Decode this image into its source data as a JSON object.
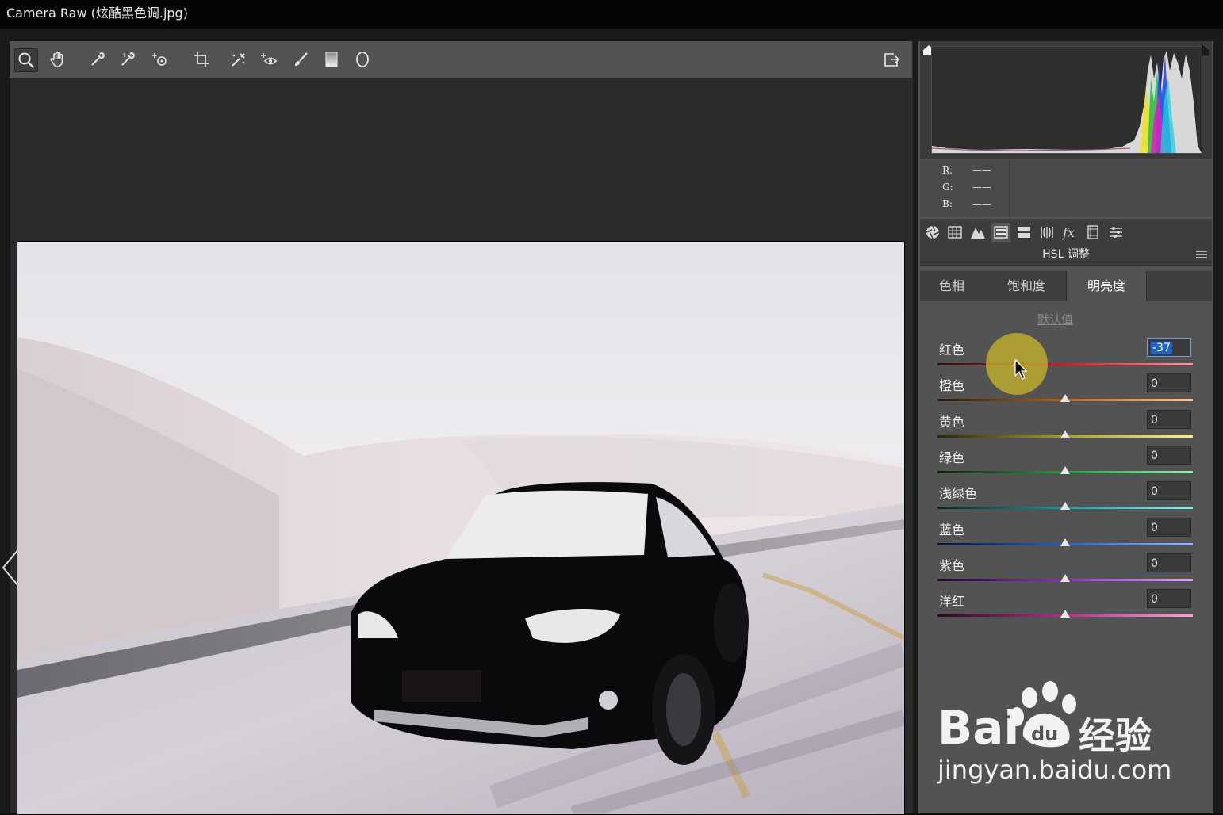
{
  "window": {
    "title": "Camera Raw (炫酷黑色调.jpg)"
  },
  "toolbar": {
    "tools": [
      "zoom-icon",
      "hand-icon",
      "white-balance-icon",
      "color-sampler-icon",
      "target-adjust-icon",
      "crop-icon",
      "spot-removal-icon",
      "red-eye-icon",
      "adjustment-brush-icon",
      "graduated-filter-icon",
      "radial-filter-icon"
    ],
    "export_icon": "open-preferences-icon"
  },
  "readout": {
    "r_label": "R:",
    "g_label": "G:",
    "b_label": "B:",
    "r_value": "——",
    "g_value": "——",
    "b_value": "——"
  },
  "panel": {
    "title": "HSL 调整",
    "tabs": [
      {
        "label": "色相",
        "active": false
      },
      {
        "label": "饱和度",
        "active": false
      },
      {
        "label": "明亮度",
        "active": true
      }
    ],
    "default_link": "默认值",
    "rows": [
      {
        "label": "红色",
        "value": "-37",
        "fraction": 0.31,
        "gradient": [
          "#2a1010",
          "#c81e28",
          "#ff9aa0"
        ]
      },
      {
        "label": "橙色",
        "value": "0",
        "fraction": 0.5,
        "gradient": [
          "#2a1a08",
          "#b8641e",
          "#ffc68a"
        ]
      },
      {
        "label": "黄色",
        "value": "0",
        "fraction": 0.5,
        "gradient": [
          "#2a2608",
          "#a8a020",
          "#fff08a"
        ]
      },
      {
        "label": "绿色",
        "value": "0",
        "fraction": 0.5,
        "gradient": [
          "#0a2010",
          "#2a9a3a",
          "#9af0a8"
        ]
      },
      {
        "label": "浅绿色",
        "value": "0",
        "fraction": 0.5,
        "gradient": [
          "#082424",
          "#1e9aa0",
          "#8ef0f0"
        ]
      },
      {
        "label": "蓝色",
        "value": "0",
        "fraction": 0.5,
        "gradient": [
          "#0a1430",
          "#2860c8",
          "#9ab8ff"
        ]
      },
      {
        "label": "紫色",
        "value": "0",
        "fraction": 0.5,
        "gradient": [
          "#1e0a2c",
          "#8a32c0",
          "#d8a8ff"
        ]
      },
      {
        "label": "洋红",
        "value": "0",
        "fraction": 0.5,
        "gradient": [
          "#2a0a1e",
          "#c0288a",
          "#ffa0dc"
        ]
      }
    ]
  },
  "watermark": {
    "brand": "Bai",
    "brand2": "经验",
    "du": "du",
    "url": "jingyan.baidu.com"
  }
}
